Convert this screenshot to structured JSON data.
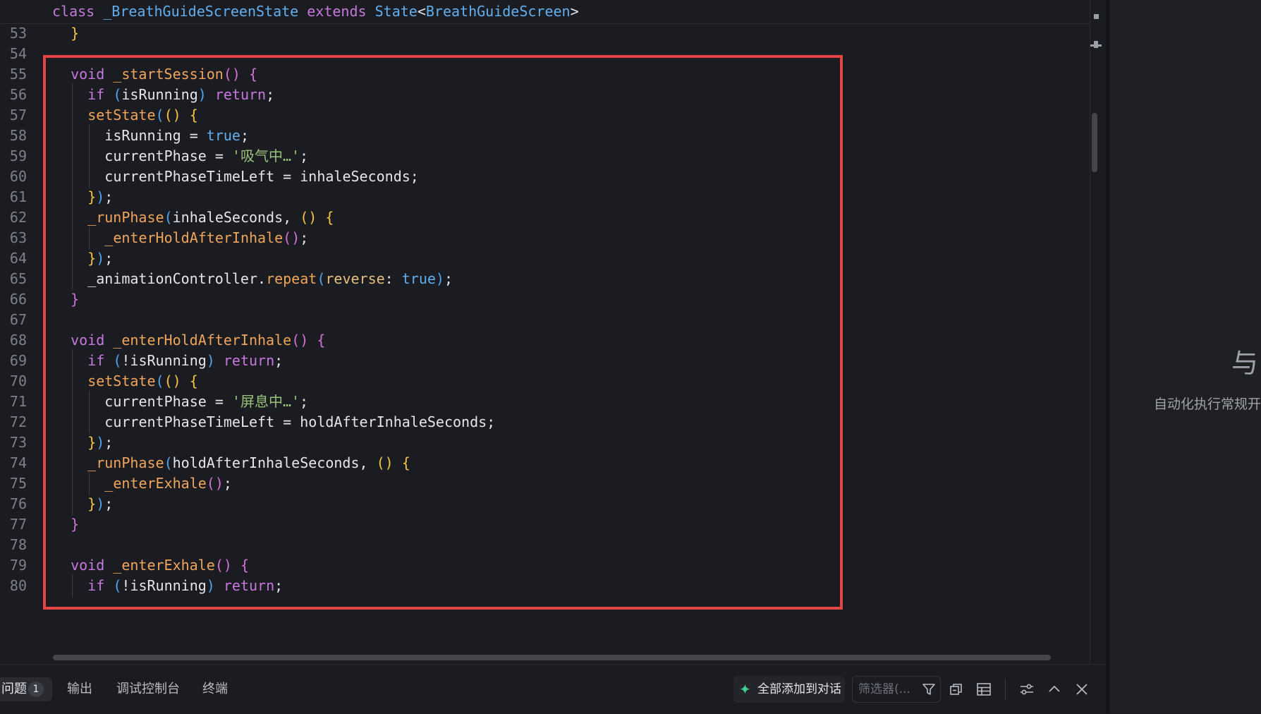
{
  "editor": {
    "sticky": {
      "tokens": [
        {
          "t": "class",
          "c": "kw"
        },
        {
          "t": " "
        },
        {
          "t": "_BreathGuideScreenState",
          "c": "ty"
        },
        {
          "t": " "
        },
        {
          "t": "extends",
          "c": "kw"
        },
        {
          "t": " "
        },
        {
          "t": "State",
          "c": "ty"
        },
        {
          "t": "<",
          "c": "op"
        },
        {
          "t": "BreathGuideScreen",
          "c": "ty"
        },
        {
          "t": ">",
          "c": "op"
        }
      ]
    },
    "lines": [
      {
        "num": "53",
        "indent": 1,
        "tokens": [
          {
            "t": "}",
            "c": "p1"
          }
        ]
      },
      {
        "num": "54",
        "indent": 0,
        "tokens": []
      },
      {
        "num": "55",
        "indent": 1,
        "tokens": [
          {
            "t": "void",
            "c": "kw"
          },
          {
            "t": " "
          },
          {
            "t": "_startSession",
            "c": "fn"
          },
          {
            "t": "()",
            "c": "p2"
          },
          {
            "t": " "
          },
          {
            "t": "{",
            "c": "p2"
          }
        ]
      },
      {
        "num": "56",
        "indent": 2,
        "tokens": [
          {
            "t": "if",
            "c": "kw"
          },
          {
            "t": " "
          },
          {
            "t": "(",
            "c": "p3"
          },
          {
            "t": "isRunning",
            "c": "var"
          },
          {
            "t": ")",
            "c": "p3"
          },
          {
            "t": " "
          },
          {
            "t": "return",
            "c": "kw"
          },
          {
            "t": ";",
            "c": "op"
          }
        ]
      },
      {
        "num": "57",
        "indent": 2,
        "tokens": [
          {
            "t": "setState",
            "c": "fn"
          },
          {
            "t": "(",
            "c": "p3"
          },
          {
            "t": "()",
            "c": "p1"
          },
          {
            "t": " "
          },
          {
            "t": "{",
            "c": "p1"
          }
        ]
      },
      {
        "num": "58",
        "indent": 3,
        "tokens": [
          {
            "t": "isRunning",
            "c": "var"
          },
          {
            "t": " = ",
            "c": "op"
          },
          {
            "t": "true",
            "c": "bool"
          },
          {
            "t": ";",
            "c": "op"
          }
        ]
      },
      {
        "num": "59",
        "indent": 3,
        "tokens": [
          {
            "t": "currentPhase",
            "c": "var"
          },
          {
            "t": " = ",
            "c": "op"
          },
          {
            "t": "'吸气中…'",
            "c": "str"
          },
          {
            "t": ";",
            "c": "op"
          }
        ]
      },
      {
        "num": "60",
        "indent": 3,
        "tokens": [
          {
            "t": "currentPhaseTimeLeft",
            "c": "var"
          },
          {
            "t": " = ",
            "c": "op"
          },
          {
            "t": "inhaleSeconds",
            "c": "var"
          },
          {
            "t": ";",
            "c": "op"
          }
        ]
      },
      {
        "num": "61",
        "indent": 2,
        "tokens": [
          {
            "t": "}",
            "c": "p1"
          },
          {
            "t": ")",
            "c": "p3"
          },
          {
            "t": ";",
            "c": "op"
          }
        ]
      },
      {
        "num": "62",
        "indent": 2,
        "tokens": [
          {
            "t": "_runPhase",
            "c": "fn"
          },
          {
            "t": "(",
            "c": "p3"
          },
          {
            "t": "inhaleSeconds",
            "c": "var"
          },
          {
            "t": ", ",
            "c": "op"
          },
          {
            "t": "()",
            "c": "p1"
          },
          {
            "t": " "
          },
          {
            "t": "{",
            "c": "p1"
          }
        ]
      },
      {
        "num": "63",
        "indent": 3,
        "tokens": [
          {
            "t": "_enterHoldAfterInhale",
            "c": "fn"
          },
          {
            "t": "()",
            "c": "p2"
          },
          {
            "t": ";",
            "c": "op"
          }
        ]
      },
      {
        "num": "64",
        "indent": 2,
        "tokens": [
          {
            "t": "}",
            "c": "p1"
          },
          {
            "t": ")",
            "c": "p3"
          },
          {
            "t": ";",
            "c": "op"
          }
        ]
      },
      {
        "num": "65",
        "indent": 2,
        "tokens": [
          {
            "t": "_animationController",
            "c": "var"
          },
          {
            "t": ".",
            "c": "op"
          },
          {
            "t": "repeat",
            "c": "fn"
          },
          {
            "t": "(",
            "c": "p3"
          },
          {
            "t": "reverse",
            "c": "param"
          },
          {
            "t": ": ",
            "c": "op"
          },
          {
            "t": "true",
            "c": "bool"
          },
          {
            "t": ")",
            "c": "p3"
          },
          {
            "t": ";",
            "c": "op"
          }
        ]
      },
      {
        "num": "66",
        "indent": 1,
        "tokens": [
          {
            "t": "}",
            "c": "p2"
          }
        ]
      },
      {
        "num": "67",
        "indent": 0,
        "tokens": []
      },
      {
        "num": "68",
        "indent": 1,
        "tokens": [
          {
            "t": "void",
            "c": "kw"
          },
          {
            "t": " "
          },
          {
            "t": "_enterHoldAfterInhale",
            "c": "fn"
          },
          {
            "t": "()",
            "c": "p2"
          },
          {
            "t": " "
          },
          {
            "t": "{",
            "c": "p2"
          }
        ]
      },
      {
        "num": "69",
        "indent": 2,
        "tokens": [
          {
            "t": "if",
            "c": "kw"
          },
          {
            "t": " "
          },
          {
            "t": "(",
            "c": "p3"
          },
          {
            "t": "!isRunning",
            "c": "var"
          },
          {
            "t": ")",
            "c": "p3"
          },
          {
            "t": " "
          },
          {
            "t": "return",
            "c": "kw"
          },
          {
            "t": ";",
            "c": "op"
          }
        ]
      },
      {
        "num": "70",
        "indent": 2,
        "tokens": [
          {
            "t": "setState",
            "c": "fn"
          },
          {
            "t": "(",
            "c": "p3"
          },
          {
            "t": "()",
            "c": "p1"
          },
          {
            "t": " "
          },
          {
            "t": "{",
            "c": "p1"
          }
        ]
      },
      {
        "num": "71",
        "indent": 3,
        "tokens": [
          {
            "t": "currentPhase",
            "c": "var"
          },
          {
            "t": " = ",
            "c": "op"
          },
          {
            "t": "'屏息中…'",
            "c": "str"
          },
          {
            "t": ";",
            "c": "op"
          }
        ]
      },
      {
        "num": "72",
        "indent": 3,
        "tokens": [
          {
            "t": "currentPhaseTimeLeft",
            "c": "var"
          },
          {
            "t": " = ",
            "c": "op"
          },
          {
            "t": "holdAfterInhaleSeconds",
            "c": "var"
          },
          {
            "t": ";",
            "c": "op"
          }
        ]
      },
      {
        "num": "73",
        "indent": 2,
        "tokens": [
          {
            "t": "}",
            "c": "p1"
          },
          {
            "t": ")",
            "c": "p3"
          },
          {
            "t": ";",
            "c": "op"
          }
        ]
      },
      {
        "num": "74",
        "indent": 2,
        "tokens": [
          {
            "t": "_runPhase",
            "c": "fn"
          },
          {
            "t": "(",
            "c": "p3"
          },
          {
            "t": "holdAfterInhaleSeconds",
            "c": "var"
          },
          {
            "t": ", ",
            "c": "op"
          },
          {
            "t": "()",
            "c": "p1"
          },
          {
            "t": " "
          },
          {
            "t": "{",
            "c": "p1"
          }
        ]
      },
      {
        "num": "75",
        "indent": 3,
        "tokens": [
          {
            "t": "_enterExhale",
            "c": "fn"
          },
          {
            "t": "()",
            "c": "p2"
          },
          {
            "t": ";",
            "c": "op"
          }
        ]
      },
      {
        "num": "76",
        "indent": 2,
        "tokens": [
          {
            "t": "}",
            "c": "p1"
          },
          {
            "t": ")",
            "c": "p3"
          },
          {
            "t": ";",
            "c": "op"
          }
        ]
      },
      {
        "num": "77",
        "indent": 1,
        "tokens": [
          {
            "t": "}",
            "c": "p2"
          }
        ]
      },
      {
        "num": "78",
        "indent": 0,
        "tokens": []
      },
      {
        "num": "79",
        "indent": 1,
        "tokens": [
          {
            "t": "void",
            "c": "kw"
          },
          {
            "t": " "
          },
          {
            "t": "_enterExhale",
            "c": "fn"
          },
          {
            "t": "()",
            "c": "p2"
          },
          {
            "t": " "
          },
          {
            "t": "{",
            "c": "p2"
          }
        ]
      },
      {
        "num": "80",
        "indent": 2,
        "tokens": [
          {
            "t": "if",
            "c": "kw"
          },
          {
            "t": " "
          },
          {
            "t": "(",
            "c": "p3"
          },
          {
            "t": "!isRunning",
            "c": "var"
          },
          {
            "t": ")",
            "c": "p3"
          },
          {
            "t": " "
          },
          {
            "t": "return",
            "c": "kw"
          },
          {
            "t": ";",
            "c": "op"
          }
        ]
      }
    ]
  },
  "side_panel": {
    "icon": "与",
    "text": "自动化执行常规开"
  },
  "bottom_panel": {
    "tabs": [
      {
        "label": "问题",
        "badge": "1"
      },
      {
        "label": "输出"
      },
      {
        "label": "调试控制台"
      },
      {
        "label": "终端"
      }
    ],
    "add_all_label": "全部添加到对话",
    "filter_placeholder": "筛选器(...",
    "icons": [
      "filter-icon",
      "collapse-all-icon",
      "table-view-icon",
      "settings-sliders-icon",
      "chevron-up-icon",
      "close-icon"
    ]
  },
  "colors": {
    "background": "#1b1c21",
    "keyword": "#c678dd",
    "type": "#61afef",
    "function": "#f0a55b",
    "string": "#98c379",
    "highlight_box": "#e34545",
    "ai_accent": "#3ecf8e"
  }
}
